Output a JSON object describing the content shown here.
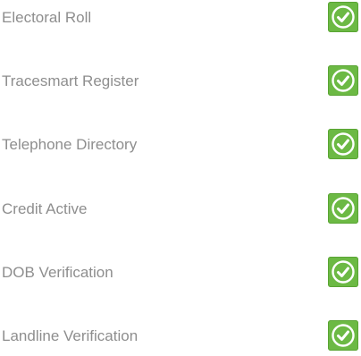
{
  "checks": [
    {
      "label": "Electoral Roll",
      "status": "verified",
      "icon": "check-circle-icon"
    },
    {
      "label": "Tracesmart Register",
      "status": "verified",
      "icon": "check-circle-icon"
    },
    {
      "label": "Telephone Directory",
      "status": "verified",
      "icon": "check-circle-icon"
    },
    {
      "label": "Credit Active",
      "status": "verified",
      "icon": "check-circle-icon"
    },
    {
      "label": "DOB Verification",
      "status": "verified",
      "icon": "check-circle-icon"
    },
    {
      "label": "Landline Verification",
      "status": "verified",
      "icon": "check-circle-icon"
    }
  ],
  "colors": {
    "label_text": "#8e8e8e",
    "check_bg": "#6cb944",
    "check_mark": "#ffffff"
  }
}
